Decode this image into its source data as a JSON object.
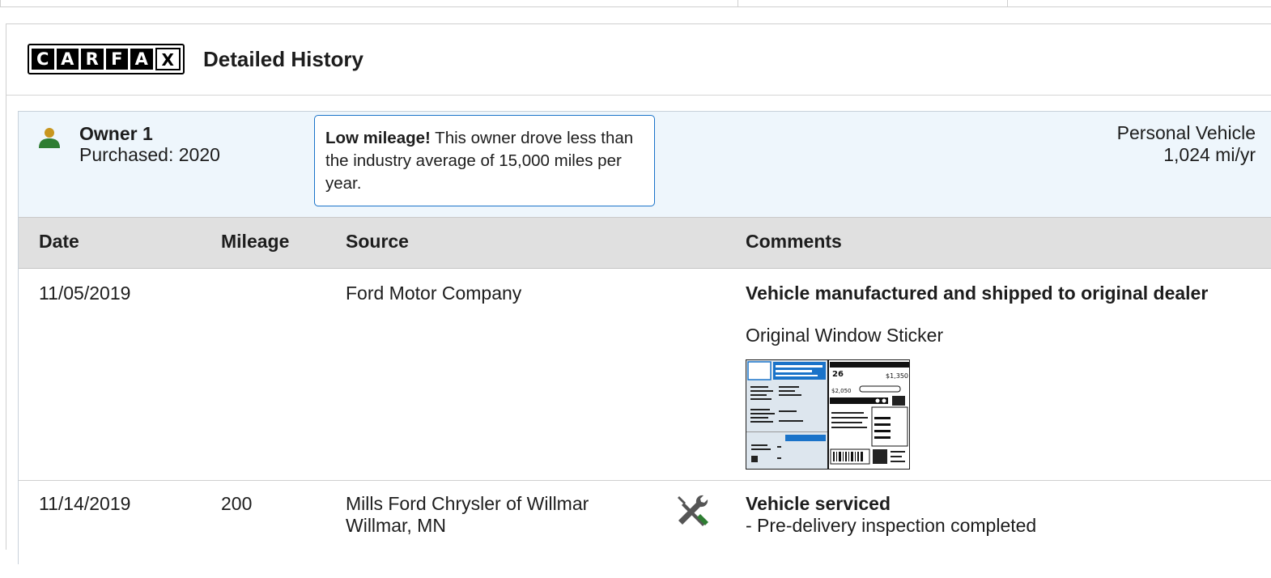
{
  "header": {
    "logo_letters": [
      "C",
      "A",
      "R",
      "F",
      "A",
      "X"
    ],
    "title": "Detailed History"
  },
  "owner": {
    "name": "Owner 1",
    "purchased": "Purchased: 2020",
    "callout_bold": "Low mileage!",
    "callout_text": " This owner drove less than the industry average of 15,000 miles per year.",
    "vehicle_type": "Personal Vehicle",
    "mileage_rate": "1,024 mi/yr",
    "icon": "person-icon",
    "icon_color": "#2e7d32"
  },
  "table": {
    "columns": [
      "Date",
      "Mileage",
      "Source",
      "Comments"
    ],
    "rows": [
      {
        "date": "11/05/2019",
        "mileage": "",
        "source_line1": "Ford Motor Company",
        "source_line2": "",
        "comment_title": "Vehicle manufactured and shipped to original dealer",
        "comment_detail": "Original Window Sticker",
        "has_sticker": true
      },
      {
        "date": "11/14/2019",
        "mileage": "200",
        "source_line1": "Mills Ford Chrysler of Willmar",
        "source_line2": "Willmar, MN",
        "comment_title": "Vehicle serviced",
        "comment_detail": "- Pre-delivery inspection completed",
        "icon": "wrench-screwdriver-icon"
      }
    ]
  },
  "colors": {
    "accent_blue": "#1a73c9",
    "owner_bar_bg": "#eef6fc",
    "header_row_bg": "#e0e0e0",
    "service_icon_green": "#2e7d32",
    "service_icon_gray": "#555555"
  }
}
